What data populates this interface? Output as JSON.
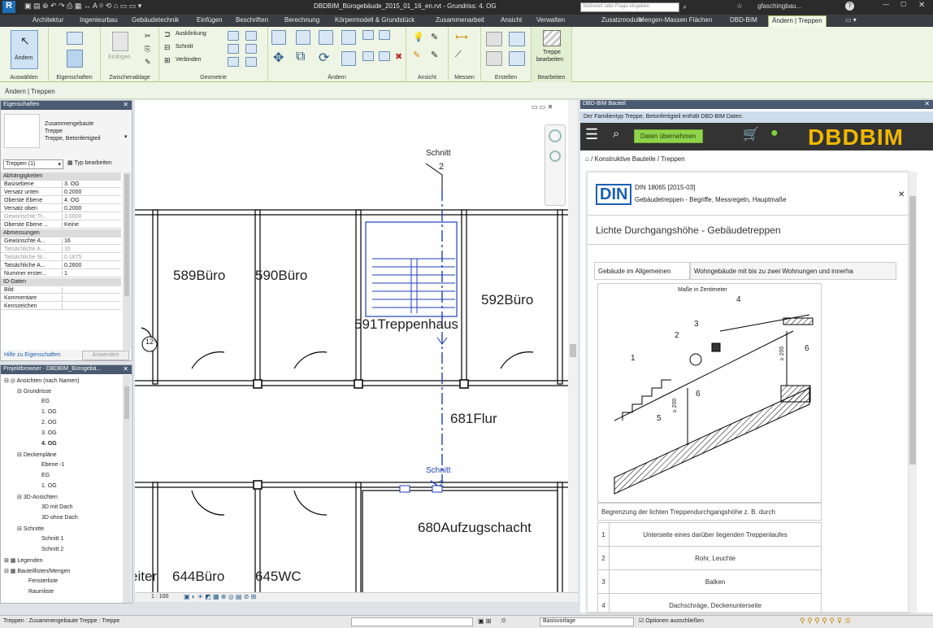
{
  "window": {
    "title": "DBDBIM_Bürogebäude_2015_01_16_en.rvt - Grundriss: 4. OG",
    "search_placeholder": "Stichwort oder Frage eingeben",
    "user": "gfaschingbau...",
    "help": "?"
  },
  "ribbon_tabs": [
    "Architektur",
    "Ingenieurbau",
    "Gebäudetechnik",
    "Einfügen",
    "Beschriften",
    "Berechnung",
    "Körpermodell & Grundstück",
    "Zusammenarbeit",
    "Ansicht",
    "Verwalten",
    "Zusatzmodule",
    "Mengen-Massen Flächen",
    "DBD-BIM",
    "Ändern | Treppen"
  ],
  "ribbon": {
    "groups": [
      "Auswählen",
      "Eigenschaften",
      "Zwischenablage",
      "Geometrie",
      "Ändern",
      "Ansicht",
      "Messen",
      "Erstellen",
      "Bearbeiten"
    ],
    "aendern_label": "Ändern",
    "einfuegen_label": "Einfügen",
    "auskl": "Ausklinkung",
    "schnitt": "Schnitt",
    "verbinden": "Verbinden",
    "treppe_label1": "Treppe",
    "treppe_label2": "bearbeiten"
  },
  "context_bar": "Ändern | Treppen",
  "properties": {
    "title": "Eigenschaften",
    "type_lines": [
      "Zusammengebaute",
      "Treppe",
      "Treppe, Betonfertigteil"
    ],
    "selector": "Treppen (1)",
    "edit_type": "Typ bearbeiten",
    "sections": {
      "abh": "Abhängigkeiten",
      "abm": "Abmessungen",
      "id": "ID-Daten"
    },
    "rows_abh": [
      {
        "k": "Basisebene",
        "v": "3. OG"
      },
      {
        "k": "Versatz unten",
        "v": "0.2000"
      },
      {
        "k": "Oberste Ebene",
        "v": "4. OG"
      },
      {
        "k": "Versatz oben",
        "v": "0.2000"
      },
      {
        "k": "Gewünschte Tr...",
        "v": "3.0000"
      },
      {
        "k": "Oberste Ebene ...",
        "v": "Keine"
      }
    ],
    "rows_abm": [
      {
        "k": "Gewünschte A...",
        "v": "16"
      },
      {
        "k": "Tatsächliche A...",
        "v": "16"
      },
      {
        "k": "Tatsächliche St...",
        "v": "0.1875"
      },
      {
        "k": "Tatsächliche A...",
        "v": "0.2600"
      },
      {
        "k": "Nummer erster...",
        "v": "1"
      }
    ],
    "rows_id": [
      {
        "k": "Bild",
        "v": ""
      },
      {
        "k": "Kommentare",
        "v": ""
      },
      {
        "k": "Kennzeichen",
        "v": ""
      }
    ],
    "help_link": "Hilfe zu Eigenschaften",
    "apply": "Anwenden"
  },
  "browser": {
    "title": "Projektbrowser - DBDBIM_Bürogebä...",
    "items": [
      "Ansichten (nach Namen)",
      "Grundrisse",
      "EG",
      "1. OG",
      "2. OG",
      "3. OG",
      "4. OG",
      "Deckenpläne",
      "Ebene -1",
      "EG",
      "1. OG",
      "3D-Ansichten",
      "3D mit Dach",
      "3D ohne Dach",
      "Schnitte",
      "Schnitt 1",
      "Schnitt 2",
      "Legenden",
      "Bauteillisten/Mengen",
      "Fensterliste",
      "Raumliste"
    ]
  },
  "drawing": {
    "rooms": [
      "589Büro",
      "590Büro",
      "591Treppenhaus",
      "592Büro",
      "681Flur",
      "680Aufzugschacht",
      "eiter",
      "644Büro",
      "645WC"
    ],
    "section_label": "Schnitt",
    "section_num": "2",
    "section_label2": "Schnitt",
    "section_num2": "2",
    "scale": "1 : 100",
    "tag": "12⁵"
  },
  "dbd": {
    "panel_title": "DBD-BIM Bauteil",
    "info": "Der Familientyp Treppe, Betonfertigteil enthält DBD-BIM Daten.",
    "button": "Daten übernehmen",
    "logo": "DBDBIM",
    "breadcrumb": "/ Konstruktive Bauteile / Treppen",
    "din_logo": "DIN",
    "din_title": "DIN 18065 [2015-03]",
    "din_subtitle": "Gebäudetreppen - Begriffe, Messregeln, Hauptmaße",
    "heading": "Lichte Durchgangshöhe - Gebäudetreppen",
    "tab1": "Gebäude im Allgemeinen",
    "tab2": "Wohngebäude mit bis zu zwei Wohnungen und innerha",
    "fig_caption": "Maße in Zentimeter",
    "fig_labels": [
      "1",
      "2",
      "3",
      "4",
      "5",
      "6",
      "6",
      "≥ 200",
      "≥ 200"
    ],
    "table_header": "Begrenzung der lichten Treppendurchgangshöhe z. B. durch",
    "table": [
      {
        "n": "1",
        "t": "Unterseite eines darüber liegenden Treppenlaufes"
      },
      {
        "n": "2",
        "t": "Rohr, Leuchte"
      },
      {
        "n": "3",
        "t": "Balken"
      },
      {
        "n": "4",
        "t": "Dachschräge, Deckenunterseite"
      }
    ]
  },
  "statusbar": {
    "left": "Treppen : Zusammengebaute Treppe : Treppe",
    "model": "Basisvorlage",
    "options": "Optionen ausschließen",
    "zero": ":0"
  }
}
